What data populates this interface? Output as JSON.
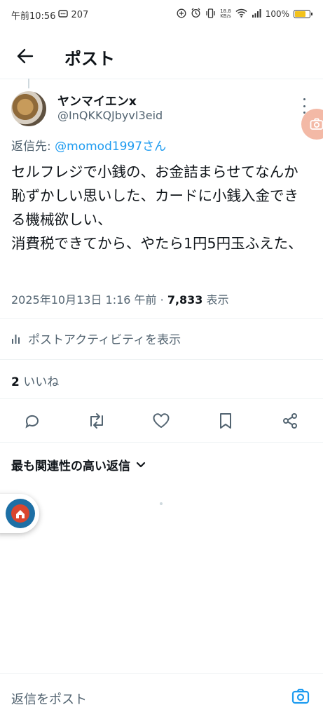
{
  "status_bar": {
    "time": "午前10:56",
    "notification_count": "207",
    "net_speed_top": "18.8",
    "net_speed_unit": "KB/s",
    "battery": "100%"
  },
  "header": {
    "title": "ポスト"
  },
  "post": {
    "author_name": "ヤンマイエンx",
    "author_handle": "@InQKKQJbyvI3eid",
    "reply_to_prefix": "返信先: ",
    "reply_to_mention": "@momod1997さん",
    "text": "セルフレジで小銭の、お金詰まらせてなんか恥ずかしい思いした、カードに小銭入金できる機械欲しい、\n消費税できてから、やたら1円5円玉ふえた、",
    "timestamp": "2025年10月13日 1:16 午前 · ",
    "views_count": "7,833",
    "views_label": " 表示",
    "activity_label": "ポストアクティビティを表示",
    "likes_count": "2",
    "likes_label": " いいね"
  },
  "replies": {
    "sort_label": "最も関連性の高い返信"
  },
  "compose": {
    "placeholder": "返信をポスト"
  },
  "colors": {
    "accent": "#1d9bf0",
    "secondary_text": "#536471"
  }
}
